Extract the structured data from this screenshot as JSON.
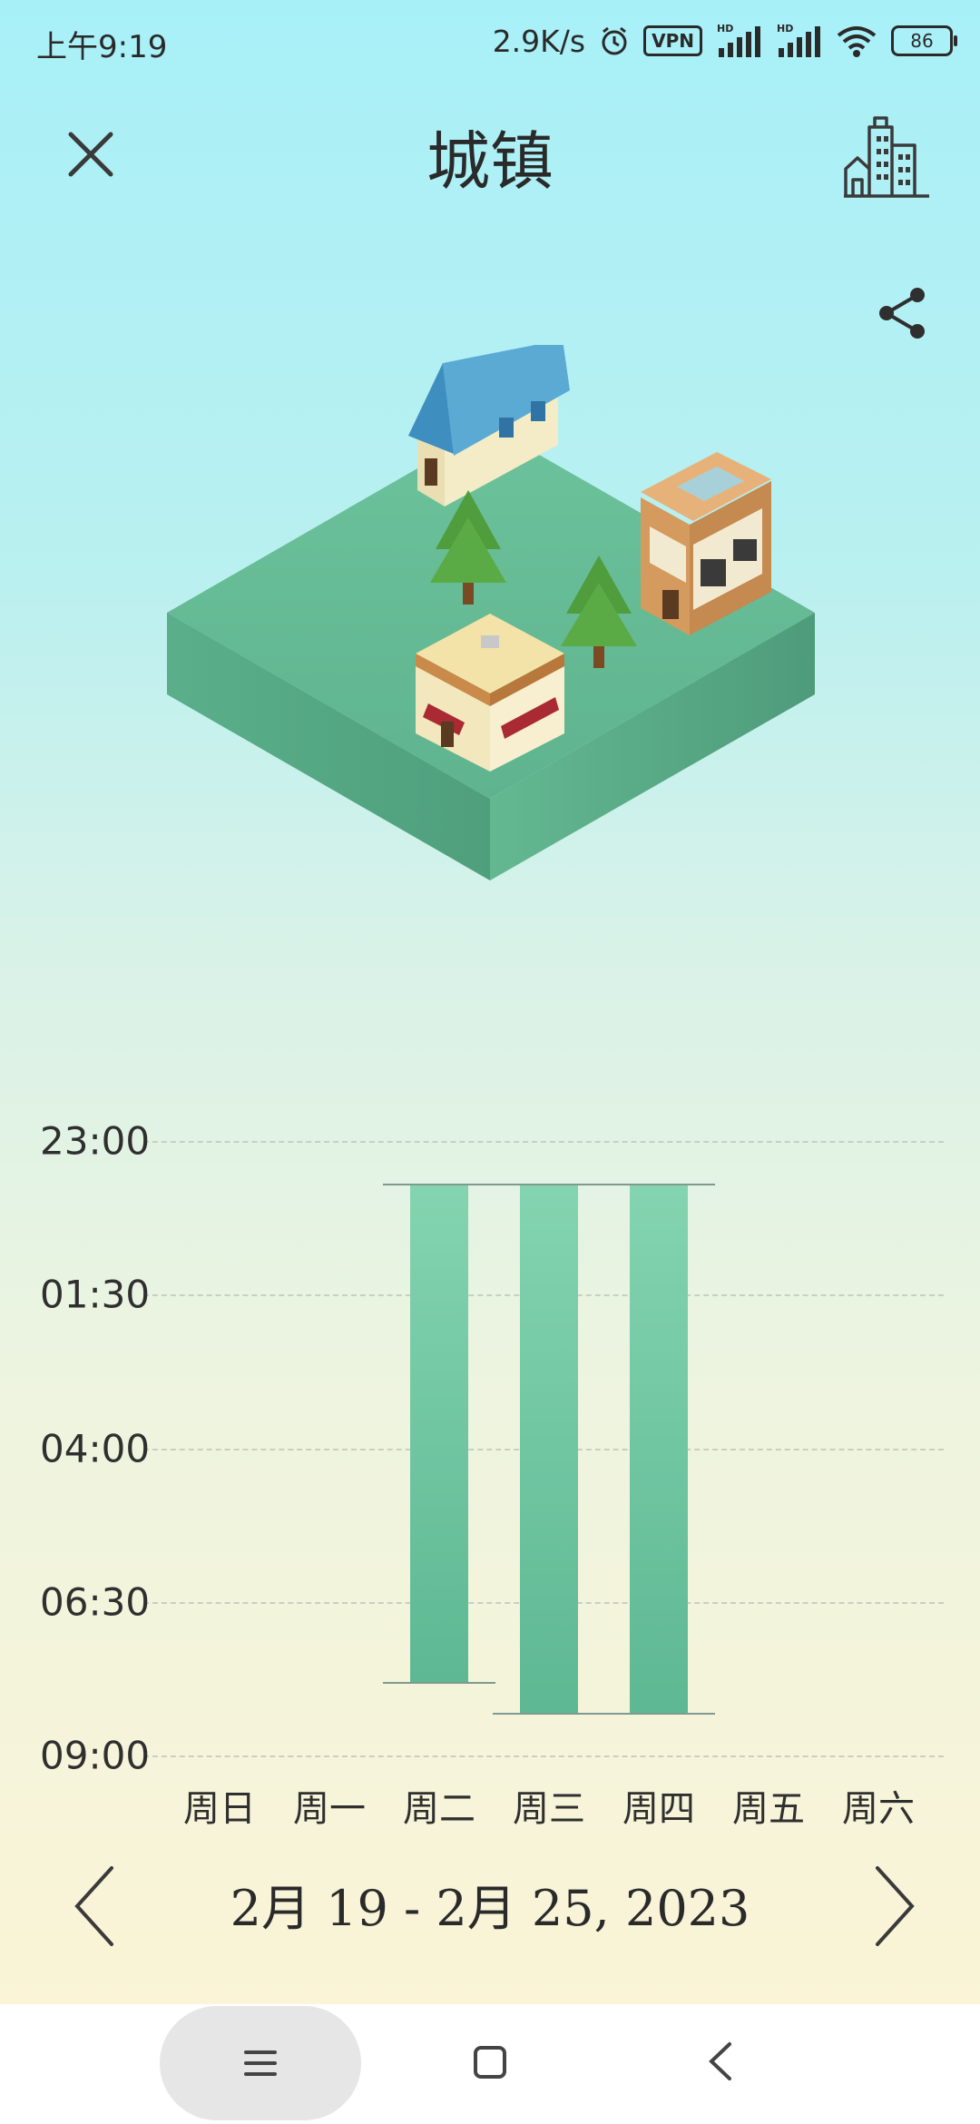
{
  "status_bar": {
    "time": "上午9:19",
    "net_speed": "2.9K/s",
    "vpn": "VPN",
    "hd": "HD",
    "battery": "86"
  },
  "header": {
    "title": "城镇",
    "close_icon": "close-icon",
    "city_icon": "city-buildings-icon",
    "share_icon": "share-icon"
  },
  "chart_data": {
    "type": "bar",
    "categories": [
      "周日",
      "周一",
      "周二",
      "周三",
      "周四",
      "周五",
      "周六"
    ],
    "y_tick_labels": [
      "23:00",
      "01:30",
      "04:00",
      "06:30",
      "09:00"
    ],
    "y_tick_hours_since_2300": [
      0,
      2.5,
      5,
      7.5,
      10
    ],
    "series": [
      {
        "ranges": [
          null,
          null,
          {
            "start": "23:42",
            "end": "07:48"
          },
          {
            "start": "23:42",
            "end": "08:18"
          },
          {
            "start": "23:42",
            "end": "08:18"
          },
          null,
          null
        ]
      }
    ],
    "y_axis_inverted": true,
    "grid": true,
    "colors": {
      "bar_top": "#84d4b0",
      "bar_bottom": "#5db893"
    }
  },
  "nav": {
    "date_range": "2月 19  - 2月 25, 2023",
    "prev_icon": "chevron-left-icon",
    "next_icon": "chevron-right-icon"
  },
  "system_nav": {
    "menu_icon": "menu-icon",
    "home_icon": "home-icon",
    "back_icon": "back-icon"
  }
}
